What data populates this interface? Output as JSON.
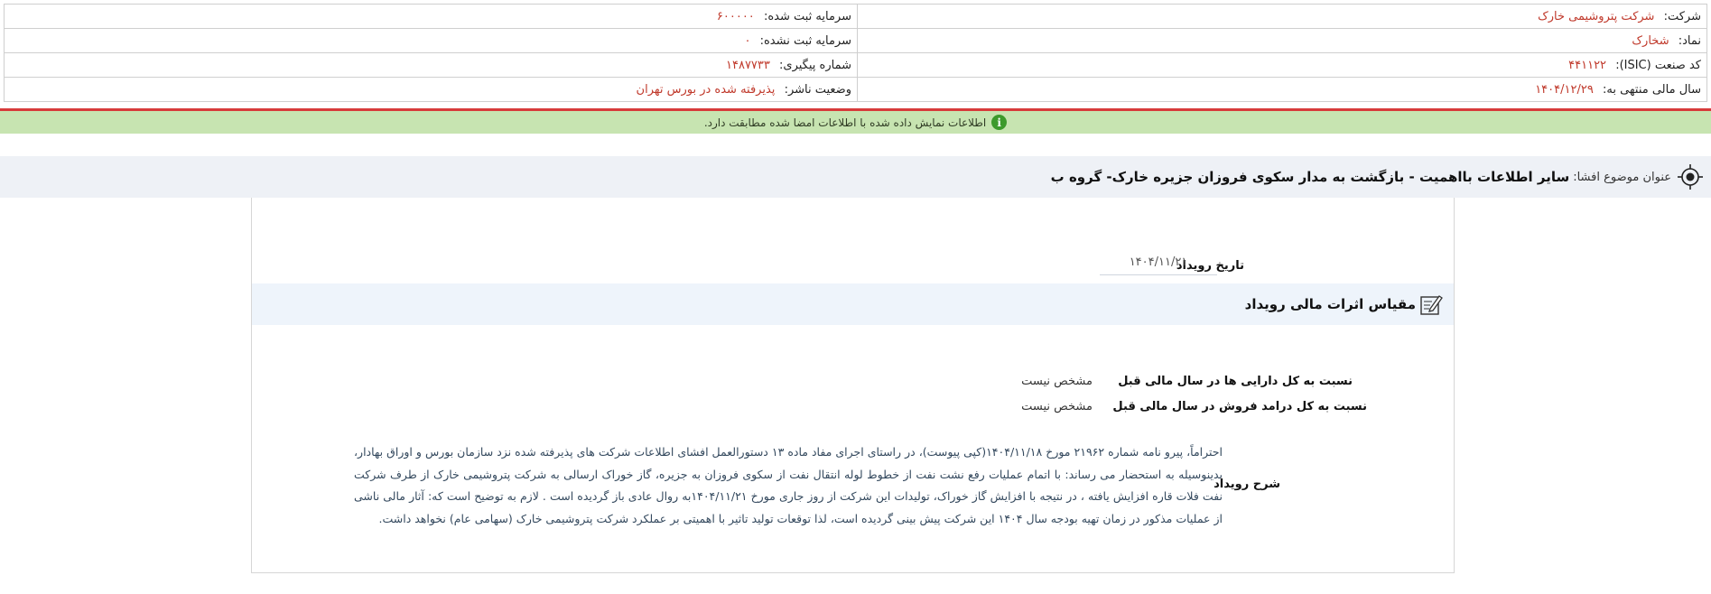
{
  "header": {
    "company_label": "شرکت:",
    "company_value": "شرکت پتروشیمی خارک",
    "registered_capital_label": "سرمایه ثبت شده:",
    "registered_capital_value": "۶۰۰۰۰۰",
    "symbol_label": "نماد:",
    "symbol_value": "شخارک",
    "unregistered_capital_label": "سرمایه ثبت نشده:",
    "unregistered_capital_value": "۰",
    "isic_label": "کد صنعت (ISIC):",
    "isic_value": "۴۴۱۱۲۲",
    "tracking_label": "شماره پیگیری:",
    "tracking_value": "۱۴۸۷۷۳۳",
    "fiscal_year_label": "سال مالی منتهی به:",
    "fiscal_year_value": "۱۴۰۴/۱۲/۲۹",
    "publisher_status_label": "وضعیت ناشر:",
    "publisher_status_value": "پذیرفته شده در بورس تهران"
  },
  "banner": {
    "icon": "info-icon",
    "text": "اطلاعات نمایش داده شده با اطلاعات امضا شده مطابقت دارد."
  },
  "subject": {
    "icon": "target-icon",
    "label": "عنوان موضوع افشا:",
    "value": "سایر اطلاعات بااهمیت - بازگشت به مدار سکوی فروزان جزیره خارک- گروه ب"
  },
  "event": {
    "date_label": "تاریخ رویداد",
    "date_value": "۱۴۰۴/۱۱/۲۱",
    "section_icon": "edit-icon",
    "section_title": "مقیاس اثرات مالی رویداد",
    "assets_ratio_label": "نسبت به کل دارایی ها در سال مالی قبل",
    "assets_ratio_value": "مشخص نیست",
    "revenue_ratio_label": "نسبت به کل درامد فروش در سال مالی قبل",
    "revenue_ratio_value": "مشخص نیست",
    "description_label": "شرح رویداد",
    "description_text": "احتراماً، پیرو نامه شماره ۲۱۹۶۲ مورخ ۱۴۰۴/۱۱/۱۸(کپی پیوست)، در راستای اجرای مفاد ماده ۱۳ دستورالعمل افشای اطلاعات شرکت های پذیرفته شده نزد سازمان بورس و اوراق بهادار، بدینوسیله به استحضار می رساند: با اتمام عملیات رفع نشت نفت از خطوط لوله انتقال نفت از سکوی فروزان به جزیره، گاز خوراک ارسالی به شرکت پتروشیمی خارک از طرف شرکت نفت فلات قاره افزایش یافته ، در نتیجه با افزایش گاز خوراک، تولیدات این شرکت از روز جاری مورخ ۱۴۰۴/۱۱/۲۱به روال عادی باز گردیده است . لازم به توضیح است که: آثار مالی ناشی از عملیات مذکور در زمان تهیه بودجه سال ۱۴۰۴ این شرکت پیش بینی گردیده است، لذا توقعات تولید تاثیر با اهمیتی بر عملکرد شرکت پتروشیمی خارک (سهامی عام) نخواهد داشت."
  }
}
